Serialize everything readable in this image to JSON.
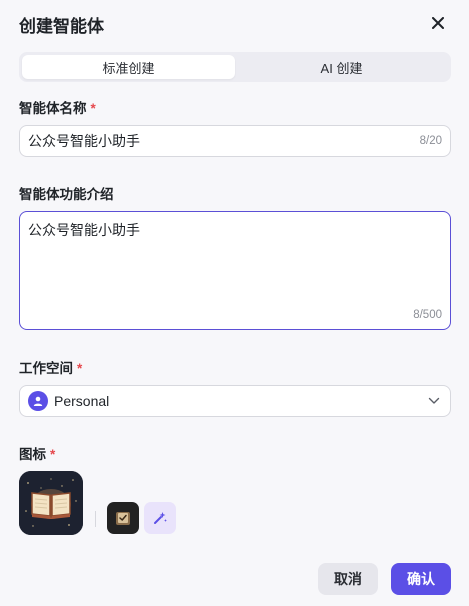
{
  "dialog": {
    "title": "创建智能体",
    "close_icon": "close-icon"
  },
  "tabs": [
    {
      "label": "标准创建",
      "active": true
    },
    {
      "label": "AI 创建",
      "active": false
    }
  ],
  "name_field": {
    "label": "智能体名称",
    "required_mark": "*",
    "value": "公众号智能小助手",
    "count": "8/20"
  },
  "description_field": {
    "label": "智能体功能介绍",
    "value": "公众号智能小助手",
    "count": "8/500"
  },
  "workspace_field": {
    "label": "工作空间",
    "required_mark": "*",
    "value": "Personal",
    "avatar_icon": "user-icon",
    "chevron_icon": "chevron-down-icon"
  },
  "icon_field": {
    "label": "图标",
    "required_mark": "*",
    "selected_icon": "book-icon",
    "options": [
      "book-check-icon",
      "ai-sparkle-icon"
    ]
  },
  "actions": {
    "cancel_label": "取消",
    "confirm_label": "确认"
  },
  "colors": {
    "accent": "#5b4fe6",
    "required": "#e5484d",
    "background": "#f7f7fa"
  }
}
